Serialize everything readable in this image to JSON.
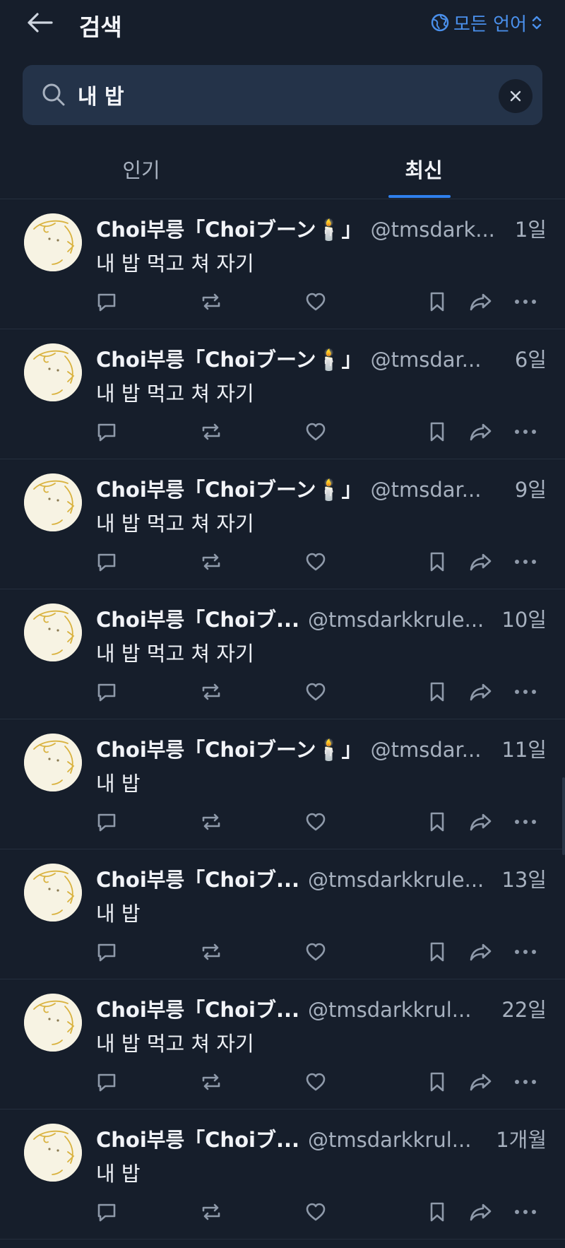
{
  "header": {
    "title": "검색",
    "language_label": "모든 언어"
  },
  "search": {
    "query": "내 밥"
  },
  "tabs": [
    {
      "label": "인기",
      "active": false
    },
    {
      "label": "최신",
      "active": true
    }
  ],
  "colors": {
    "accent": "#2f80ed",
    "link": "#4a90ec",
    "background": "#161e2b",
    "search_bg": "#243349"
  },
  "icons": [
    "back-arrow-icon",
    "globe-icon",
    "chevron-updown-icon",
    "search-icon",
    "close-icon",
    "reply-icon",
    "repost-icon",
    "like-icon",
    "bookmark-icon",
    "share-icon",
    "more-icon"
  ],
  "posts": [
    {
      "author": "Choi부릉「Choiブーン🕯️」",
      "handle": "@tmsdark...",
      "time": "1일",
      "text": "내 밥 먹고 쳐 자기"
    },
    {
      "author": "Choi부릉「Choiブーン🕯️」",
      "handle": "@tmsdar...",
      "time": "6일",
      "text": "내 밥 먹고 쳐 자기"
    },
    {
      "author": "Choi부릉「Choiブーン🕯️」",
      "handle": "@tmsdar...",
      "time": "9일",
      "text": "내 밥 먹고 쳐 자기"
    },
    {
      "author": "Choi부릉「Choiブ...",
      "handle": "@tmsdarkkrule...",
      "time": "10일",
      "text": "내 밥 먹고 쳐 자기"
    },
    {
      "author": "Choi부릉「Choiブーン🕯️」",
      "handle": "@tmsdar...",
      "time": "11일",
      "text": "내 밥"
    },
    {
      "author": "Choi부릉「Choiブ...",
      "handle": "@tmsdarkkrule...",
      "time": "13일",
      "text": "내 밥"
    },
    {
      "author": "Choi부릉「Choiブ...",
      "handle": "@tmsdarkkrul...",
      "time": "22일",
      "text": "내 밥 먹고 쳐 자기"
    },
    {
      "author": "Choi부릉「Choiブ...",
      "handle": "@tmsdarkkrul...",
      "time": "1개월",
      "text": "내 밥"
    }
  ]
}
